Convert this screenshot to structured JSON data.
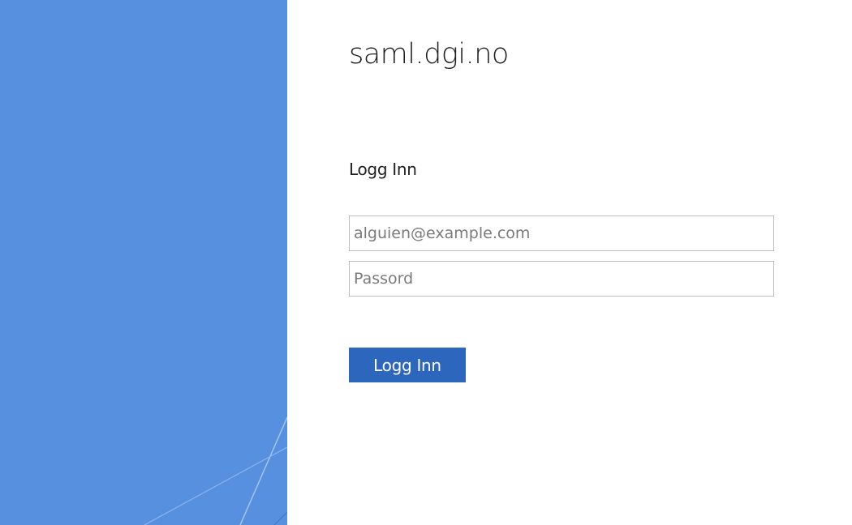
{
  "colors": {
    "illustration_background": "#5890e0",
    "accent_button": "#2c66bd",
    "field_border": "#bdbdbd"
  },
  "header": {
    "company_name": "saml.dgi.no"
  },
  "login_form": {
    "heading": "Logg Inn",
    "username_placeholder": "alguien@example.com",
    "username_value": "",
    "password_placeholder": "Passord",
    "password_value": "",
    "submit_label": "Logg Inn"
  }
}
